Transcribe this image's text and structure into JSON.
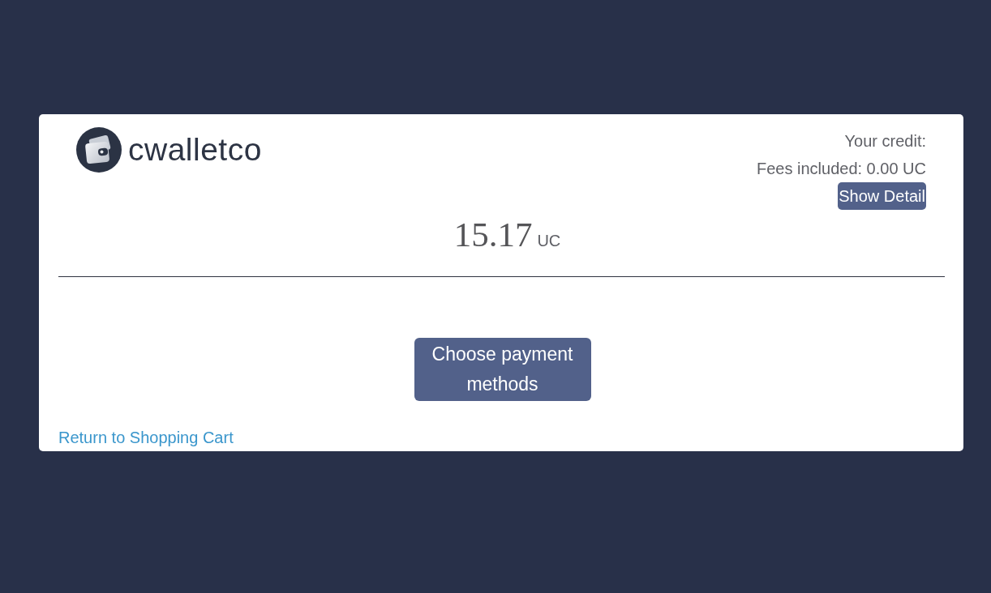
{
  "logo": {
    "text": "cwalletco"
  },
  "credit": {
    "label": "Your credit:",
    "fees": "Fees included: 0.00 UC",
    "detail_button": "Show Detail",
    "amount": "15.17",
    "currency": "UC"
  },
  "actions": {
    "payment_button": "Choose payment methods"
  },
  "return_link": "Return to Shopping Cart"
}
